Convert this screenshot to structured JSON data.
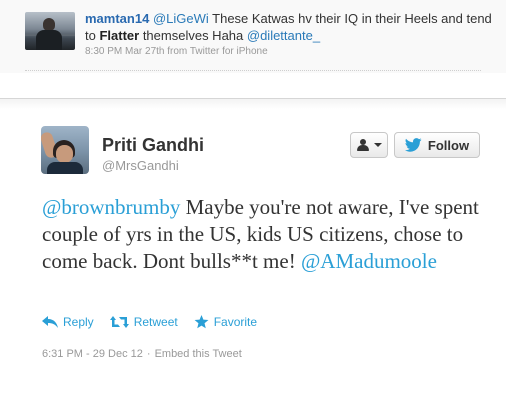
{
  "previous_tweet": {
    "username": "mamtan14",
    "mention_1": "@LiGeWi",
    "text_1": " These Katwas hv their IQ in their Heels and tend to ",
    "bold_word": "Flatter",
    "text_2": " themselves Haha ",
    "mention_2": "@dilettante_",
    "meta": "8:30 PM Mar 27th from Twitter for iPhone"
  },
  "tweet": {
    "display_name": "Priti Gandhi",
    "handle": "@MrsGandhi",
    "follow_label": "Follow",
    "mention_1": "@brownbrumby",
    "text": " Maybe you're not aware, I've spent couple of yrs in the US, kids US citizens, chose to come back. Dont bulls**t me! ",
    "mention_2": "@AMadumoole",
    "actions": {
      "reply": "Reply",
      "retweet": "Retweet",
      "favorite": "Favorite"
    },
    "timestamp": "6:31 PM - 29 Dec 12",
    "separator": "·",
    "embed_label": "Embed this Tweet"
  },
  "colors": {
    "link": "#2a9fd6",
    "username": "#2a6ab0",
    "muted": "#999999",
    "text": "#333333"
  },
  "icons": [
    "user-icon",
    "twitter-bird-icon",
    "reply-icon",
    "retweet-icon",
    "favorite-star-icon"
  ]
}
